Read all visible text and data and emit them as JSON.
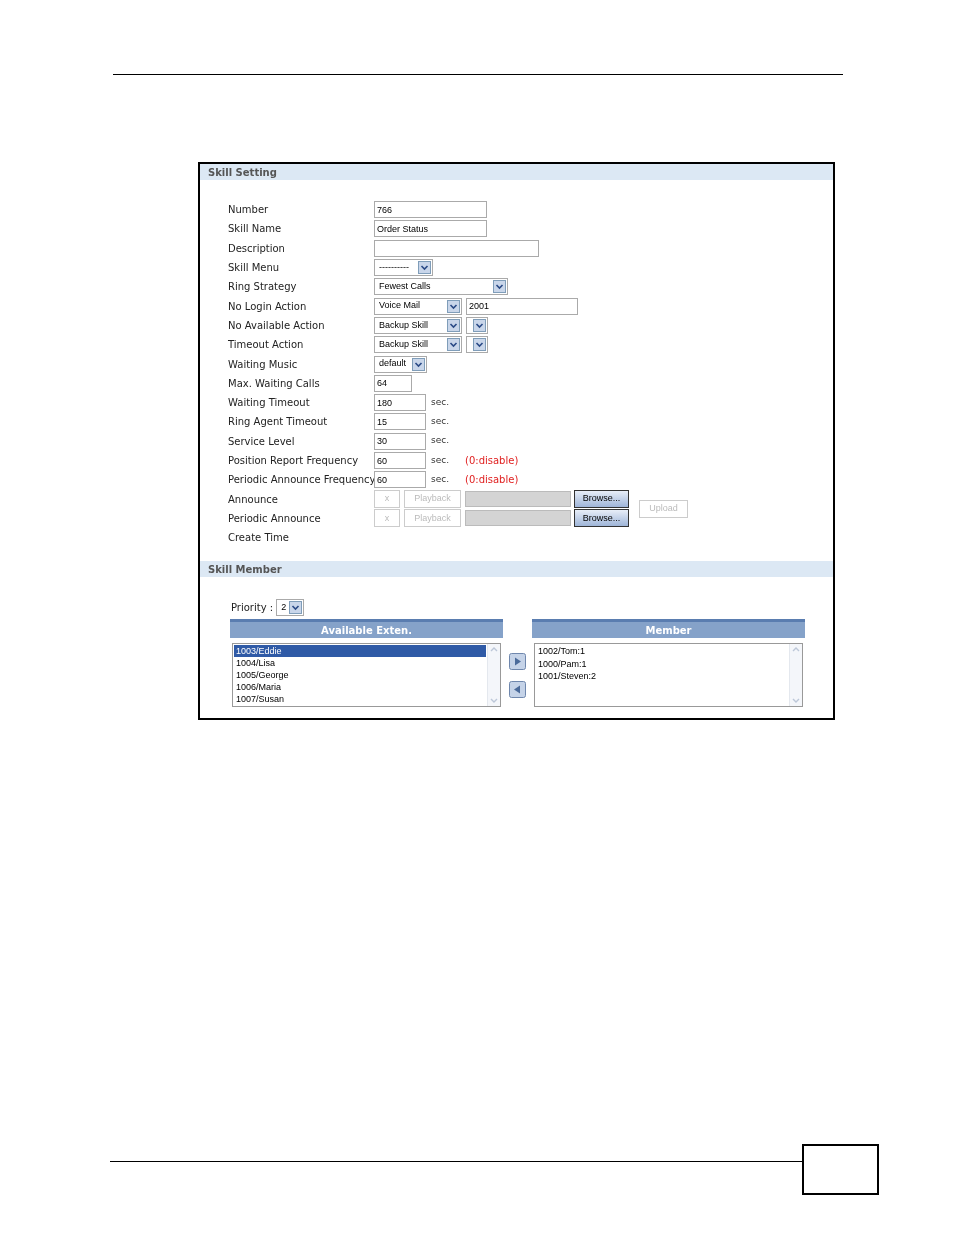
{
  "skill_setting": {
    "title": "Skill Setting",
    "fields": [
      {
        "label": "Number",
        "kind": "text",
        "value": "766"
      },
      {
        "label": "Skill Name",
        "kind": "text",
        "value": "Order Status"
      },
      {
        "label": "Description",
        "kind": "text"
      },
      {
        "label": "Skill Menu",
        "kind": "select",
        "value": "----------"
      },
      {
        "label": "Ring Strategy",
        "kind": "select",
        "value": "Fewest Calls"
      },
      {
        "label": "No Login Action",
        "kind": "select_text",
        "value": "Voice Mail",
        "extra": "2001"
      },
      {
        "label": "No Available Action",
        "kind": "select_pair",
        "value": "Backup Skill"
      },
      {
        "label": "Timeout Action",
        "kind": "select_pair",
        "value": "Backup Skill"
      },
      {
        "label": "Waiting Music",
        "kind": "select",
        "value": "default"
      },
      {
        "label": "Max. Waiting Calls",
        "kind": "text",
        "value": "64"
      },
      {
        "label": "Waiting Timeout",
        "kind": "text",
        "value": "180",
        "unit": "sec."
      },
      {
        "label": "Ring Agent Timeout",
        "kind": "text",
        "value": "15",
        "unit": "sec."
      },
      {
        "label": "Service Level",
        "kind": "text",
        "value": "30",
        "unit": "sec."
      },
      {
        "label": "Position Report Frequency",
        "kind": "text",
        "value": "60",
        "unit": "sec.",
        "note": "(0:disable)"
      },
      {
        "label": "Periodic Announce Frequency",
        "kind": "text",
        "value": "60",
        "unit": "sec.",
        "note": "(0:disable)"
      },
      {
        "label": "Announce",
        "kind": "file",
        "clear": "x",
        "playback": "Playback",
        "browse": "Browse...",
        "disabled": true,
        "upload": {
          "label": "Upload",
          "disabled": true
        }
      },
      {
        "label": "Periodic Announce",
        "kind": "file",
        "clear": "x",
        "playback": "Playback",
        "browse": "Browse...",
        "disabled": true
      },
      {
        "label": "Create Time",
        "kind": "plain"
      }
    ]
  },
  "skill_member": {
    "title": "Skill Member",
    "priority_label": "Priority :",
    "priority": "2",
    "available": {
      "title": "Available Exten.",
      "items": [
        {
          "label": "1003/Eddie",
          "selected": true
        },
        {
          "label": "1004/Lisa",
          "selected": false
        },
        {
          "label": "1005/George",
          "selected": false
        },
        {
          "label": "1006/Maria",
          "selected": false
        },
        {
          "label": "1007/Susan",
          "selected": false
        }
      ]
    },
    "member": {
      "title": "Member",
      "items": [
        {
          "label": "1002/Tom:1",
          "selected": false
        },
        {
          "label": "1000/Pam:1",
          "selected": false
        },
        {
          "label": "1001/Steven:2",
          "selected": false
        }
      ]
    }
  }
}
